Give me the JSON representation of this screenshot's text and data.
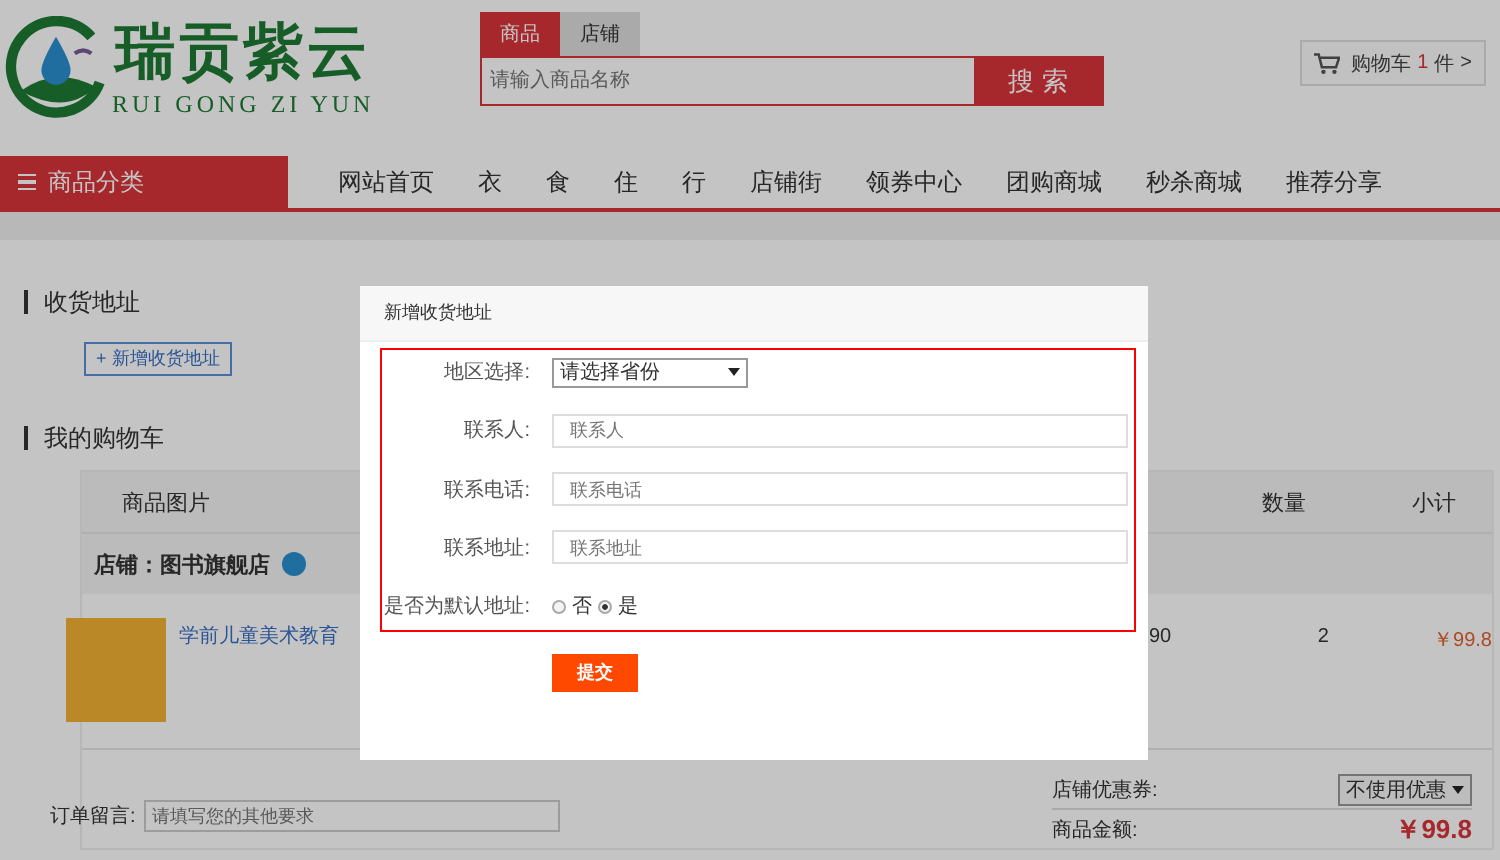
{
  "header": {
    "logo": {
      "name": "瑞贡紫云",
      "pinyin": "RUI GONG ZI YUN"
    },
    "search": {
      "tabs": [
        {
          "label": "商品",
          "selected": true
        },
        {
          "label": "店铺",
          "selected": false
        }
      ],
      "placeholder": "请输入商品名称",
      "button": "搜 索"
    },
    "cart": {
      "label": "购物车",
      "count": "1",
      "unit": "件",
      "arrow": ">"
    }
  },
  "nav": {
    "category_button": "商品分类",
    "items": [
      "网站首页",
      "衣",
      "食",
      "住",
      "行",
      "店铺街",
      "领券中心",
      "团购商城",
      "秒杀商城",
      "推荐分享"
    ]
  },
  "address_section": {
    "title": "收货地址",
    "add_button": "+ 新增收货地址"
  },
  "cart_section": {
    "title": "我的购物车",
    "columns": [
      {
        "label": "商品图片"
      },
      {
        "label": "数量"
      },
      {
        "label": "小计"
      }
    ],
    "shop": {
      "label": "店铺：图书旗舰店"
    },
    "items": [
      {
        "title": "学前儿童美术教育",
        "price_fragment": "90",
        "quantity": "2",
        "subtotal": "￥99.8"
      }
    ],
    "message": {
      "label": "订单留言:",
      "placeholder": "请填写您的其他要求"
    },
    "coupon": {
      "label": "店铺优惠券:",
      "value": "不使用优惠"
    },
    "amount": {
      "label": "商品金额:",
      "value": "￥99.8"
    }
  },
  "modal": {
    "title": "新增收货地址",
    "fields": [
      {
        "kind": "select",
        "label": "地区选择:",
        "value": "请选择省份"
      },
      {
        "kind": "input",
        "label": "联系人:",
        "placeholder": "联系人"
      },
      {
        "kind": "input",
        "label": "联系电话:",
        "placeholder": "联系电话"
      },
      {
        "kind": "input",
        "label": "联系地址:",
        "placeholder": "联系地址"
      },
      {
        "kind": "radio",
        "label": "是否为默认地址:",
        "options": [
          {
            "label": "否",
            "selected": false
          },
          {
            "label": "是",
            "selected": true
          }
        ]
      }
    ],
    "submit": "提交"
  }
}
